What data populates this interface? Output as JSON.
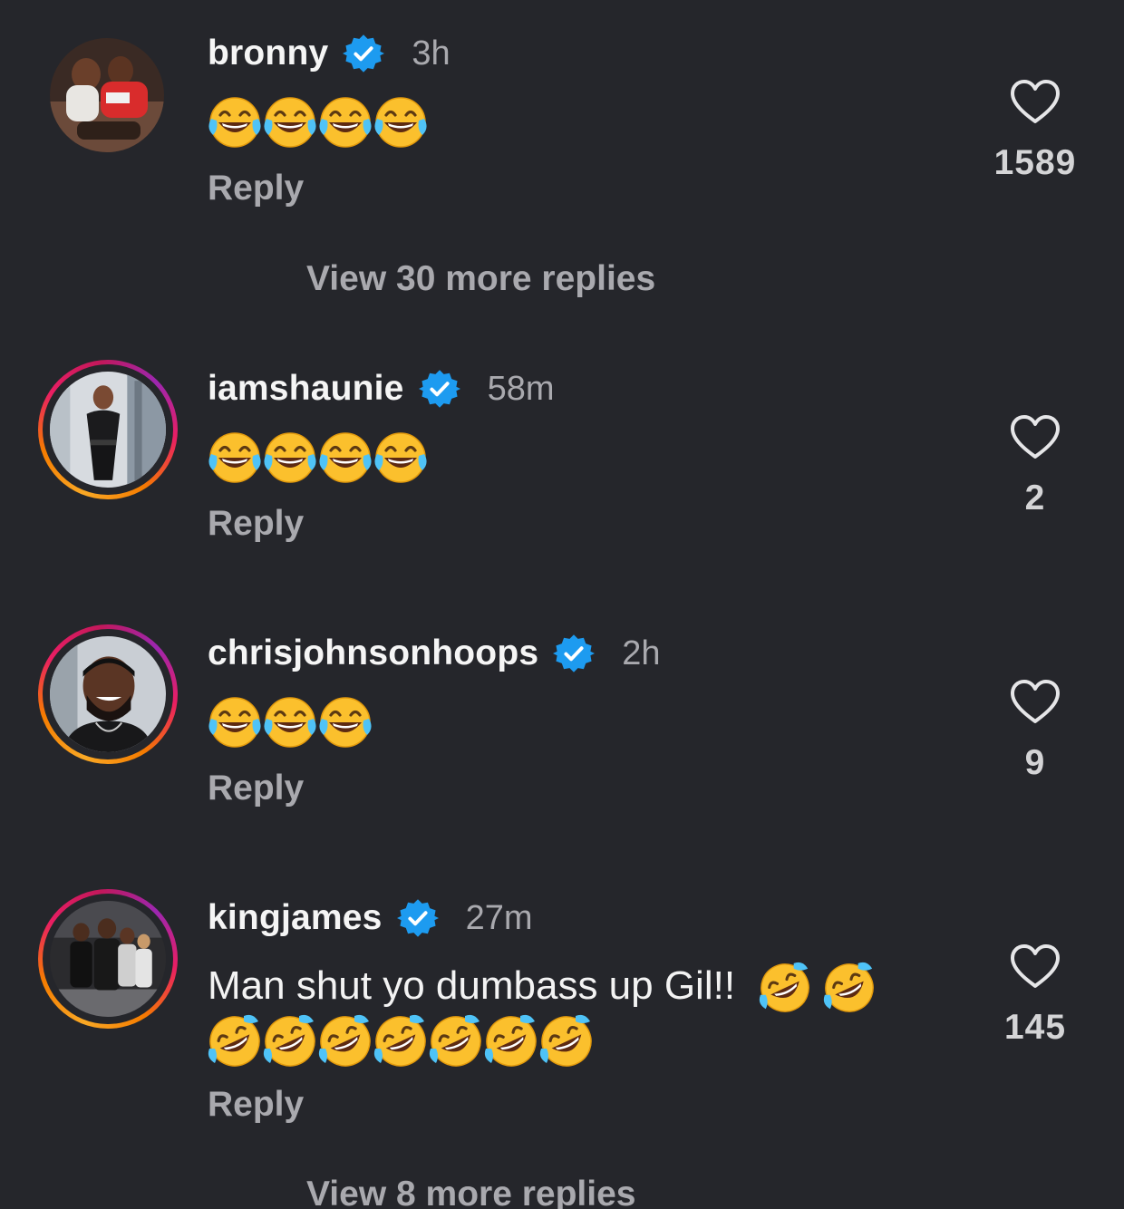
{
  "comments": [
    {
      "username": "bronny",
      "time": "3h",
      "text": "",
      "emojis": [
        "joy",
        "joy",
        "joy",
        "joy"
      ],
      "reply_label": "Reply",
      "likes": "1589",
      "avatar_icon": "bronny-avatar"
    },
    {
      "username": "iamshaunie",
      "time": "58m",
      "text": "",
      "emojis": [
        "joy",
        "joy",
        "joy",
        "joy"
      ],
      "reply_label": "Reply",
      "likes": "2",
      "avatar_icon": "iamshaunie-avatar"
    },
    {
      "username": "chrisjohnsonhoops",
      "time": "2h",
      "text": "",
      "emojis": [
        "joy",
        "joy",
        "joy"
      ],
      "reply_label": "Reply",
      "likes": "9",
      "avatar_icon": "chrisjohnsonhoops-avatar"
    },
    {
      "username": "kingjames",
      "time": "27m",
      "text": "Man shut yo dumbass up Gil!!",
      "emojis": [
        "rofl",
        "rofl",
        "rofl",
        "rofl",
        "rofl",
        "rofl",
        "rofl",
        "rofl",
        "rofl"
      ],
      "reply_label": "Reply",
      "likes": "145",
      "avatar_icon": "kingjames-avatar"
    }
  ],
  "view_more": {
    "first": "View 30 more replies",
    "second": "View 8 more replies"
  },
  "colors": {
    "background": "#25262b",
    "verified_blue": "#1d9bf0",
    "muted_text": "#a9a9ae"
  }
}
